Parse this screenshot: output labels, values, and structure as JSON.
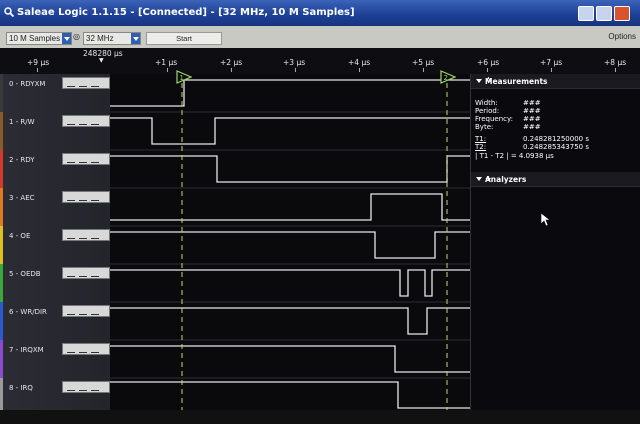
{
  "window": {
    "title": "Saleae Logic 1.1.15 - [Connected] - [32 MHz, 10 M Samples]"
  },
  "toolbar": {
    "samples_select": "10 M Samples",
    "rate_select": "32 MHz",
    "start_label": "Start",
    "options_label": "Options"
  },
  "ruler": {
    "cursor_time": "248280 µs",
    "ticks": [
      "+9 µs",
      "+1 µs",
      "+2 µs",
      "+3 µs",
      "+4 µs",
      "+5 µs",
      "+6 µs",
      "+7 µs",
      "+8 µs"
    ],
    "markers": [
      "1",
      "2"
    ]
  },
  "channels": [
    {
      "name": "0 - RDYXM",
      "color": "#3a3a3a"
    },
    {
      "name": "1 - R/W",
      "color": "#8a5a2a"
    },
    {
      "name": "2 - RDY",
      "color": "#d23a2a"
    },
    {
      "name": "3 - AEC",
      "color": "#e07a20"
    },
    {
      "name": "4 - OE",
      "color": "#e0c020"
    },
    {
      "name": "5 - OEDB",
      "color": "#3aa83a"
    },
    {
      "name": "6 - WR/DIR",
      "color": "#2a5ad0"
    },
    {
      "name": "7 - IRQXM",
      "color": "#8a4ad0"
    },
    {
      "name": "8 - IRQ",
      "color": "#9a9a9a"
    }
  ],
  "measurements": {
    "title": "Measurements",
    "rows": [
      {
        "key": "Width:",
        "value": "###"
      },
      {
        "key": "Period:",
        "value": "###"
      },
      {
        "key": "Frequency:",
        "value": "###"
      },
      {
        "key": "Byte:",
        "value": "###"
      },
      {
        "key": "T1:",
        "value": "0.248281250000 s"
      },
      {
        "key": "T2:",
        "value": "0.248285343750 s"
      }
    ],
    "delta": "| T1 - T2 | = 4.0938 µs"
  },
  "analyzers": {
    "title": "Analyzers"
  }
}
